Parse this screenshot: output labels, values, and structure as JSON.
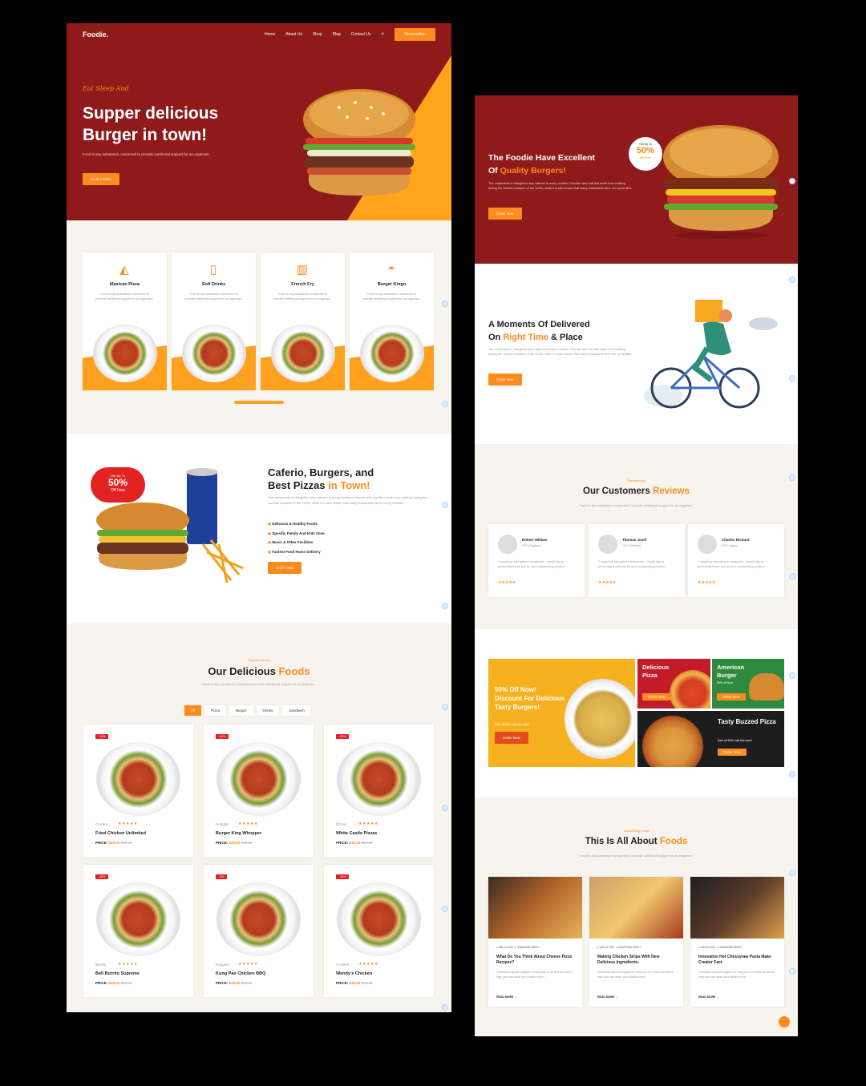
{
  "left": {
    "nav": {
      "logo": "Foodie.",
      "links": [
        "Home",
        "About Us",
        "Shop",
        "Blog",
        "Contact Us"
      ],
      "button": "Reservation"
    },
    "hero": {
      "script": "Eat Sleep And",
      "title1": "Supper delicious",
      "title2": "Burger in town!",
      "desc": "Food is any substance consumed to provide nutritional support for an organism.",
      "button": "Book A Table"
    },
    "categories": [
      {
        "icon": "pizza-slice-icon",
        "title": "Maxican Pizza",
        "desc": "Food is any substance consumed to provide nutritional support for an organism."
      },
      {
        "icon": "bottle-icon",
        "title": "Soft Drinks",
        "desc": "Food is any substance consumed to provide nutritional support for an organism."
      },
      {
        "icon": "fries-icon",
        "title": "French Fry",
        "desc": "Food is any substance consumed to provide nutritional support for an organism."
      },
      {
        "icon": "burger-icon",
        "title": "Burger Kingo",
        "desc": "Food is any substance consumed to provide nutritional support for an organism."
      }
    ],
    "about": {
      "badge_top": "Get Up To",
      "badge_pct": "50%",
      "badge_bottom": "Off Now",
      "title1": "Caferio, Burgers, and",
      "title2a": "Best Pizzas ",
      "title2b": "in Town!",
      "desc": "The restaurants in Hangzhou also catered to many northern Chinese who had fled south from Kaifeng during the Jurchen invasion of the 1120s, while it is also known that many restaurants were run by families.",
      "features": [
        "Delicious & Healthy Foods",
        "Specific Family And Kids Zone",
        "Music & Other Facilities",
        "Fastest Food Home Delivery"
      ],
      "button": "Order Now"
    },
    "dishes": {
      "eyebrow": "Popular Dishes",
      "title_a": "Our Delicious ",
      "title_b": "Foods",
      "desc": "Food is any substance consumed to provide nutritional support for an organism.",
      "tabs": [
        "All",
        "Pizza",
        "Burger",
        "Drinks",
        "Sandwich"
      ],
      "items": [
        {
          "badge": "-15%",
          "cat": "Chicken",
          "name": "Fried Chicken Unlimited",
          "price_label": "PRICE:",
          "price": "$49.00",
          "old": "$69.00"
        },
        {
          "badge": "-10%",
          "cat": "Noddles",
          "name": "Burger King Whopper",
          "price_label": "PRICE:",
          "price": "$29.00",
          "old": "$39.00"
        },
        {
          "badge": "-25%",
          "cat": "Pizzas",
          "name": "White Castle Pizzas",
          "price_label": "PRICE:",
          "price": "$49.00",
          "old": "$69.00"
        },
        {
          "badge": "-10%",
          "cat": "Burrito",
          "name": "Bell Burrito Supreme",
          "price_label": "PRICE:",
          "price": "$59.00",
          "old": "$69.00"
        },
        {
          "badge": "-5%",
          "cat": "Nuggets",
          "name": "Kung Pao Chicken BBQ",
          "price_label": "PRICE:",
          "price": "$29.00",
          "old": "$39.00"
        },
        {
          "badge": "-15%",
          "cat": "Chicken",
          "name": "Wendy's Chicken",
          "price_label": "PRICE:",
          "price": "$49.00",
          "old": "$69.00"
        }
      ]
    }
  },
  "right": {
    "hero": {
      "title1": "The Foodie Have Excellent",
      "title2a": "Of ",
      "title2b": "Quality Burgers!",
      "desc": "The restaurants in Hangzhou also catered to many northern Chinese who had fled south from Kaifeng during the Jurchen invasion of the 1120s, while it is also known that many restaurants were run by families.",
      "button": "Order Now",
      "badge_top": "Get Up To",
      "badge_pct": "50%",
      "badge_bottom": "Off Now"
    },
    "delivery": {
      "title1": "A Moments Of Delivered",
      "title2a": "On ",
      "title2b": "Right Time",
      "title2c": " & Place",
      "desc": "The restaurants in Hangzhou also catered to many northern Chinese who had fled south from Kaifeng during the Jurchen invasion of the 1120s, while it is also known that many restaurants were run by families.",
      "button": "Order Now"
    },
    "reviews": {
      "eyebrow": "Testimonials",
      "title_a": "Our Customers ",
      "title_b": "Reviews",
      "desc": "Food is any substance consumed to provide nutritional support for an organism.",
      "items": [
        {
          "name": "Robert William",
          "role": "CEO Kingfisher",
          "quote": "\"I would be lost without restaurant. I would like to personally thank you for your outstanding product.\"",
          "stars": "★★★★★"
        },
        {
          "name": "Thomas Josef",
          "role": "CEO Getflicker",
          "quote": "\"I would be lost without restaurant. I would like to personally thank you for your outstanding product.\"",
          "stars": "★★★★★"
        },
        {
          "name": "Charles Richard",
          "role": "CEO Angela",
          "quote": "\"I would be lost without restaurant. I would like to personally thank you for your outstanding product.\"",
          "stars": "★★★★★"
        }
      ]
    },
    "promos": {
      "big_l1": "50% Off Now!",
      "big_l2": "Discount For Delicious",
      "big_l3": "Tasty Burgers!",
      "big_sub": "Sale off 50% only this week",
      "big_btn": "Order Now",
      "p1": "Delicious Pizza",
      "p1_btn": "Order Now",
      "p2": "American Burger",
      "p2_sub": "50% off Now",
      "p2_btn": "Order Now",
      "p3": "Tasty Buzzed Pizza",
      "p3_sub": "Sale off 50% only this week",
      "p3_btn": "Order Now"
    },
    "blog": {
      "eyebrow": "Latest Blog Posts",
      "title_a": "This Is All About ",
      "title_b": "Foods",
      "desc": "Food is any substance consumed to provide nutritional support for an organism.",
      "posts": [
        {
          "date": "JAN 01 2022",
          "author": "JONATHAN SMITH",
          "title": "What Do You Think About Cheese Pizza Recipes?",
          "desc": "Financial experts support or help you to to find out which way you can raise your funds more...",
          "more": "READ MORE"
        },
        {
          "date": "JAN 01 2022",
          "author": "JONATHAN SMITH",
          "title": "Making Chicken Strips With New Delicious Ingredients.",
          "desc": "Financial experts support or help you to to find out which way you can raise your funds more...",
          "more": "READ MORE"
        },
        {
          "date": "JAN 01 2022",
          "author": "JONATHAN SMITH",
          "title": "Innovative Hot Chessyraw Pasta Make Creator Fact.",
          "desc": "Financial experts support or help you to to find out which way you can raise your funds more...",
          "more": "READ MORE"
        }
      ]
    }
  },
  "colors": {
    "brand_red": "#8e1a1a",
    "accent": "#ff8a1d",
    "cream": "#f7f4ee"
  }
}
